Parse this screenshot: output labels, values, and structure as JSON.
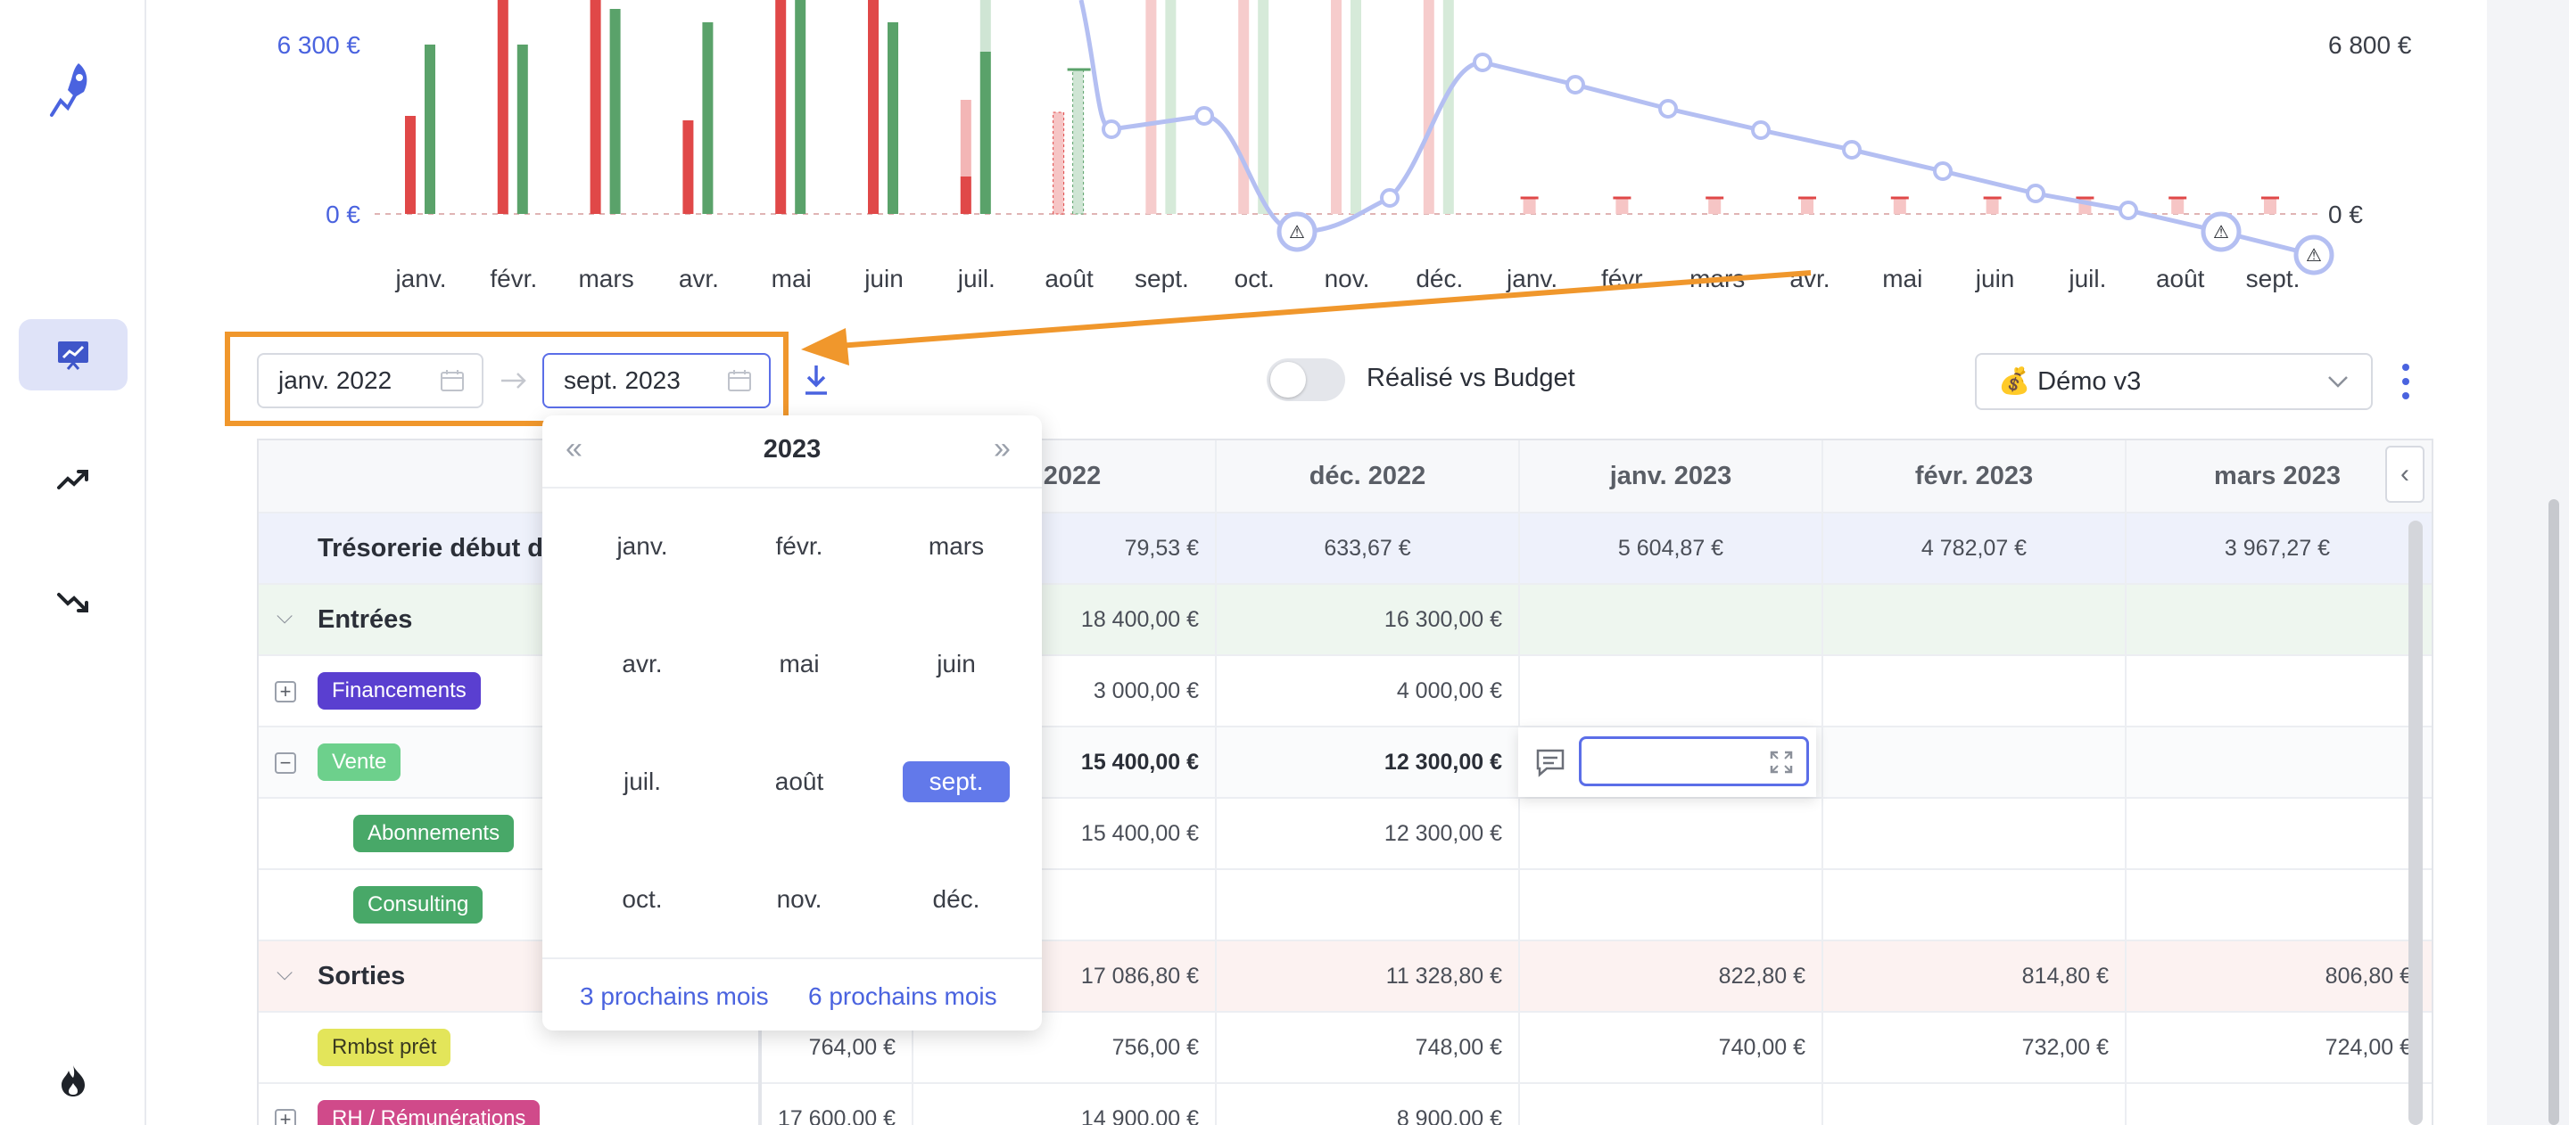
{
  "sidebar": {
    "icons": [
      "rocket-icon",
      "presentation-chart-icon",
      "trend-up-icon",
      "trend-down-icon",
      "fire-icon"
    ]
  },
  "chart": {
    "y_left_top": "6 300 €",
    "y_left_zero": "0 €",
    "y_right_top": "6 800 €",
    "y_right_zero": "0 €",
    "months": [
      "janv.",
      "févr.",
      "mars",
      "avr.",
      "mai",
      "juin",
      "juil.",
      "août",
      "sept.",
      "oct.",
      "nov.",
      "déc.",
      "janv.",
      "févr.",
      "mars",
      "avr.",
      "mai",
      "juin",
      "juil.",
      "août",
      "sept."
    ],
    "colors": {
      "income": "#5aa26a",
      "expense": "#e04848",
      "line": "#b4bff2",
      "axis_text": "#4a63df"
    }
  },
  "toolbar": {
    "start_date": "janv. 2022",
    "end_date": "sept. 2023",
    "toggle_label": "Réalisé vs Budget",
    "toggle_on": false,
    "scenario": "💰 Démo v3",
    "highlight_color": "#f0972c"
  },
  "grid": {
    "headers": [
      "v. 2022",
      "déc. 2022",
      "janv. 2023",
      "févr. 2023",
      "mars 2023"
    ],
    "rows": [
      {
        "label": "Trésorerie début de",
        "values": [
          "79,53 €",
          "633,67 €",
          "5 604,87 €",
          "4 782,07 €",
          "3 967,27 €"
        ]
      },
      {
        "label": "Entrées",
        "values": [
          "18 400,00 €",
          "16 300,00 €",
          "",
          "",
          ""
        ]
      },
      {
        "label": "Financements",
        "values": [
          "3 000,00 €",
          "4 000,00 €",
          "",
          "",
          ""
        ]
      },
      {
        "label": "Vente",
        "values": [
          "15 400,00 €",
          "12 300,00 €",
          "",
          "",
          ""
        ]
      },
      {
        "label": "Abonnements",
        "values": [
          "15 400,00 €",
          "12 300,00 €",
          "",
          "",
          ""
        ]
      },
      {
        "label": "Consulting",
        "values": [
          "",
          "",
          "",
          "",
          ""
        ]
      },
      {
        "label": "Sorties",
        "values": [
          "17 086,80 €",
          "11 328,80 €",
          "822,80 €",
          "814,80 €",
          "806,80 €"
        ]
      },
      {
        "label": "Rmbst prêt",
        "values": [
          "764,00 €",
          "756,00 €",
          "748,00 €",
          "740,00 €",
          "732,00 €",
          "724,00 €"
        ]
      },
      {
        "label": "RH / Rémunérations",
        "values": [
          "17 600,00 €",
          "14 900,00 €",
          "8 900,00 €"
        ]
      }
    ]
  },
  "datepicker": {
    "year": "2023",
    "months": [
      "janv.",
      "févr.",
      "mars",
      "avr.",
      "mai",
      "juin",
      "juil.",
      "août",
      "sept.",
      "oct.",
      "nov.",
      "déc."
    ],
    "selected": "sept.",
    "footer_left": "3 prochains mois",
    "footer_right": "6 prochains mois"
  }
}
